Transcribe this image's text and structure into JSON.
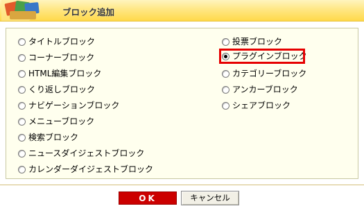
{
  "header": {
    "title": "ブロック追加"
  },
  "options_left": [
    {
      "label": "タイトルブロック",
      "checked": false
    },
    {
      "label": "コーナーブロック",
      "checked": false
    },
    {
      "label": "HTML編集ブロック",
      "checked": false
    },
    {
      "label": "くり返しブロック",
      "checked": false
    },
    {
      "label": "ナビゲーションブロック",
      "checked": false
    },
    {
      "label": "メニューブロック",
      "checked": false
    },
    {
      "label": "検索ブロック",
      "checked": false
    },
    {
      "label": "ニュースダイジェストブロック",
      "checked": false
    },
    {
      "label": "カレンダーダイジェストブロック",
      "checked": false
    }
  ],
  "options_right": [
    {
      "label": "投票ブロック",
      "checked": false
    },
    {
      "label": "プラグインブロック",
      "checked": true
    },
    {
      "label": "カテゴリーブロック",
      "checked": false
    },
    {
      "label": "アンカーブロック",
      "checked": false
    },
    {
      "label": "シェアブロック",
      "checked": false
    }
  ],
  "buttons": {
    "ok": "OK",
    "cancel": "キャンセル"
  },
  "colors": {
    "header": "#ffe26a",
    "panel": "#ffffee",
    "ok": "#cc0000",
    "highlight": "#e60000"
  }
}
